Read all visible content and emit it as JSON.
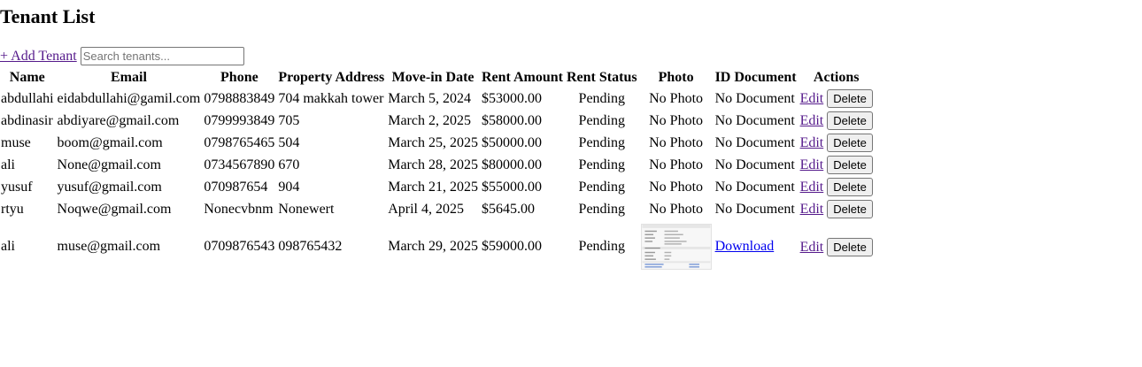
{
  "page": {
    "title": "Tenant List",
    "add_label": "+ Add Tenant",
    "search_placeholder": "Search tenants..."
  },
  "table": {
    "columns": [
      "Name",
      "Email",
      "Phone",
      "Property Address",
      "Move-in Date",
      "Rent Amount",
      "Rent Status",
      "Photo",
      "ID Document",
      "Actions"
    ],
    "rows": [
      {
        "name": "abdullahi",
        "email": "eidabdullahi@gamil.com",
        "phone": "0798883849",
        "address": "704 makkah tower",
        "move_in": "March 5, 2024",
        "rent": "$53000.00",
        "status": "Pending",
        "photo": "No Photo",
        "id_doc": "No Document",
        "edit": "Edit",
        "delete": "Delete"
      },
      {
        "name": "abdinasir",
        "email": "abdiyare@gmail.com",
        "phone": "0799993849",
        "address": "705",
        "move_in": "March 2, 2025",
        "rent": "$58000.00",
        "status": "Pending",
        "photo": "No Photo",
        "id_doc": "No Document",
        "edit": "Edit",
        "delete": "Delete"
      },
      {
        "name": "muse",
        "email": "boom@gmail.com",
        "phone": "0798765465",
        "address": "504",
        "move_in": "March 25, 2025",
        "rent": "$50000.00",
        "status": "Pending",
        "photo": "No Photo",
        "id_doc": "No Document",
        "edit": "Edit",
        "delete": "Delete"
      },
      {
        "name": "ali",
        "email": "None@gmail.com",
        "phone": "0734567890",
        "address": "670",
        "move_in": "March 28, 2025",
        "rent": "$80000.00",
        "status": "Pending",
        "photo": "No Photo",
        "id_doc": "No Document",
        "edit": "Edit",
        "delete": "Delete"
      },
      {
        "name": "yusuf",
        "email": "yusuf@gmail.com",
        "phone": "070987654",
        "address": "904",
        "move_in": "March 21, 2025",
        "rent": "$55000.00",
        "status": "Pending",
        "photo": "No Photo",
        "id_doc": "No Document",
        "edit": "Edit",
        "delete": "Delete"
      },
      {
        "name": "rtyu",
        "email": "Noqwe@gmail.com",
        "phone": "Nonecvbnm",
        "address": "Nonewert",
        "move_in": "April 4, 2025",
        "rent": "$5645.00",
        "status": "Pending",
        "photo": "No Photo",
        "id_doc": "No Document",
        "edit": "Edit",
        "delete": "Delete"
      },
      {
        "name": "ali",
        "email": "muse@gmail.com",
        "phone": "0709876543",
        "address": "098765432",
        "move_in": "March 29, 2025",
        "rent": "$59000.00",
        "status": "Pending",
        "photo": "",
        "id_doc": "Download",
        "edit": "Edit",
        "delete": "Delete"
      }
    ]
  },
  "colors": {
    "link_visited": "#551a8b",
    "link": "#0000ee",
    "button_bg": "#efefef"
  }
}
